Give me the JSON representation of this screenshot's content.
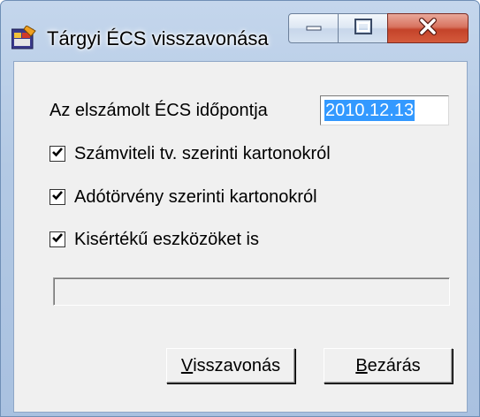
{
  "window": {
    "title": "Tárgyi ÉCS visszavonása",
    "app_icon": "application-icon",
    "controls": {
      "minimize": "minimize-icon",
      "maximize": "maximize-icon",
      "close": "close-icon"
    }
  },
  "form": {
    "date_label": "Az elszámolt ÉCS időpontja",
    "date_value": "2010.12.13",
    "checkboxes": [
      {
        "label": "Számviteli tv. szerinti kartonokról",
        "checked": true
      },
      {
        "label": "Adótörvény szerinti kartonokról",
        "checked": true
      },
      {
        "label": "Kisértékű eszközöket is",
        "checked": true
      }
    ],
    "progress": 0
  },
  "buttons": {
    "undo": {
      "mnemonic": "V",
      "rest": "isszavonás"
    },
    "close": {
      "mnemonic": "B",
      "rest": "ezárás"
    }
  }
}
